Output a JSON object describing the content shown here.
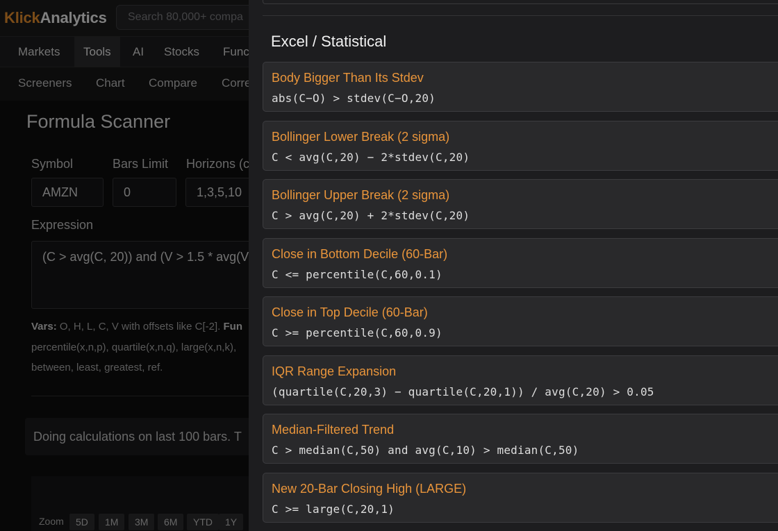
{
  "header": {
    "logo_part1": "Klick",
    "logo_part2": "Analytics",
    "search_placeholder": "Search 80,000+ compa"
  },
  "nav_primary": [
    "Markets",
    "Tools",
    "AI",
    "Stocks",
    "Func"
  ],
  "nav_primary_active": "Tools",
  "nav_secondary": [
    "Screeners",
    "Chart",
    "Compare",
    "Corre"
  ],
  "scanner": {
    "title": "Formula Scanner",
    "symbol_label": "Symbol",
    "symbol_value": "AMZN",
    "bars_limit_label": "Bars Limit",
    "bars_limit_value": "0",
    "horizons_label": "Horizons (c",
    "horizons_value": "1,3,5,10",
    "expression_label": "Expression",
    "expression_value": "(C > avg(C, 20)) and (V > 1.5 * avg(V",
    "help_vars_label": "Vars:",
    "help_line1": " O, H, L, C, V with offsets like C[-2]. ",
    "help_funcs_label": "Fun",
    "help_line2": "percentile(x,n,p), quartile(x,n,q), large(x,n,k),",
    "help_line3": "between, least, greatest, ref.",
    "calc_text": "Doing calculations on last 100 bars. T",
    "zoom_label": "Zoom",
    "zoom_options": [
      "5D",
      "1M",
      "3M",
      "6M",
      "YTD",
      "1Y"
    ]
  },
  "panel": {
    "section_title": "Excel / Statistical",
    "cards": [
      {
        "title": "Body Bigger Than Its Stdev",
        "formula": "abs(C−O) > stdev(C−O,20)"
      },
      {
        "title": "Bollinger Lower Break (2 sigma)",
        "formula": "C < avg(C,20) − 2*stdev(C,20)"
      },
      {
        "title": "Bollinger Upper Break (2 sigma)",
        "formula": "C > avg(C,20) + 2*stdev(C,20)"
      },
      {
        "title": "Close in Bottom Decile (60-Bar)",
        "formula": "C <= percentile(C,60,0.1)"
      },
      {
        "title": "Close in Top Decile (60-Bar)",
        "formula": "C >= percentile(C,60,0.9)"
      },
      {
        "title": "IQR Range Expansion",
        "formula": "(quartile(C,20,3) − quartile(C,20,1)) / avg(C,20) > 0.05"
      },
      {
        "title": "Median-Filtered Trend",
        "formula": "C > median(C,50) and avg(C,10) > median(C,50)"
      },
      {
        "title": "New 20-Bar Closing High (LARGE)",
        "formula": "C >= large(C,20,1)"
      }
    ]
  },
  "colors": {
    "accent_orange": "#e9953b",
    "panel_bg": "#1d1d1f",
    "card_bg": "#29292b"
  }
}
